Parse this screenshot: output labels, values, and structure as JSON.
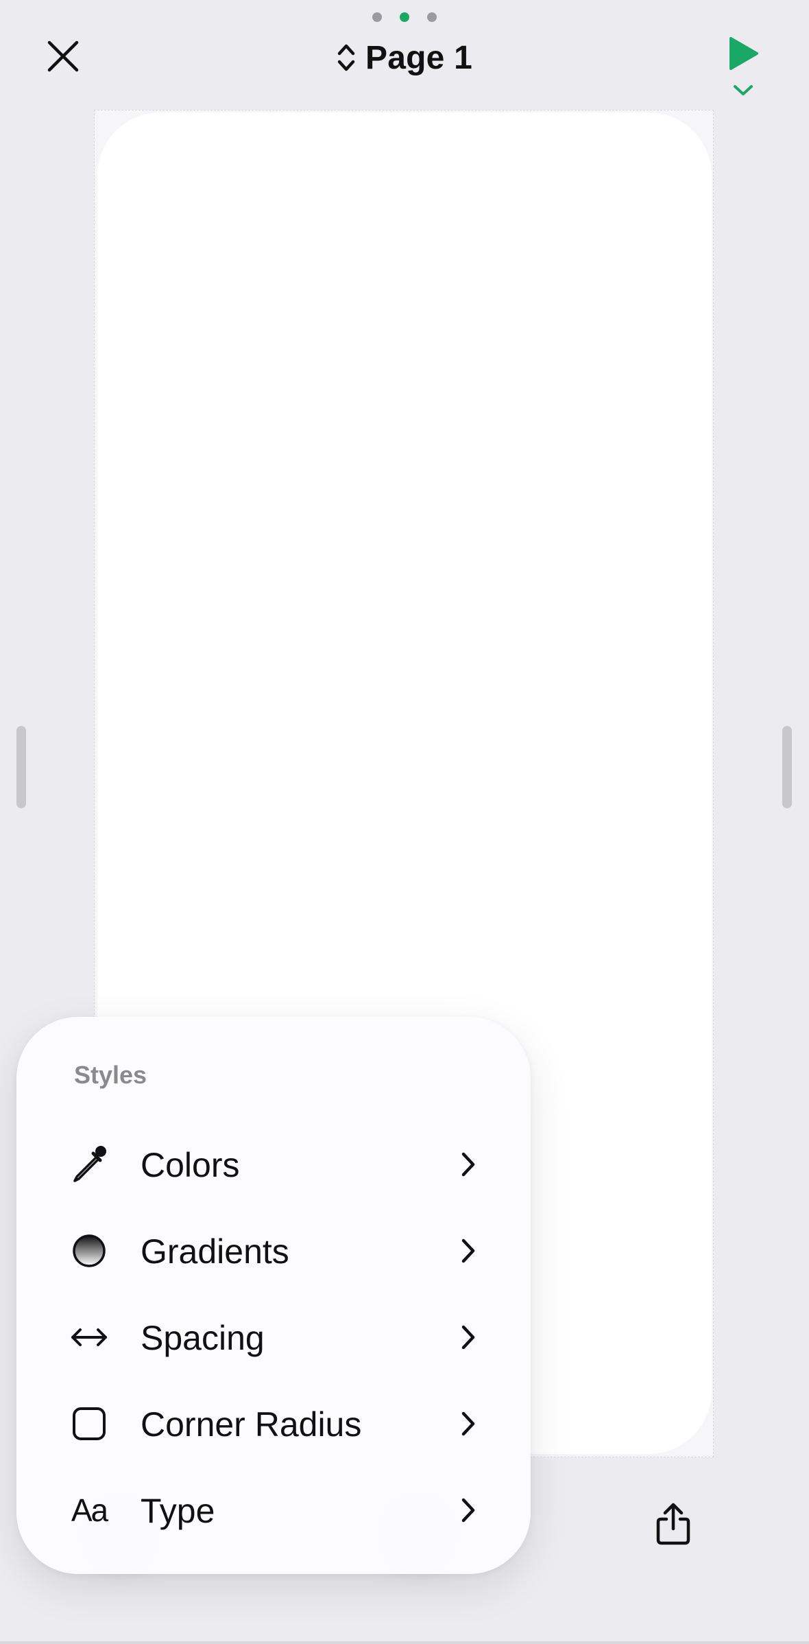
{
  "page_indicator": {
    "count": 3,
    "active_index": 1
  },
  "header": {
    "title": "Page 1",
    "accent_color": "#1aa866"
  },
  "icons": {
    "close": "close-icon",
    "page_switch": "chevron-up-down-icon",
    "play": "play-icon",
    "play_options": "chevron-down-icon",
    "share": "share-icon"
  },
  "styles_menu": {
    "title": "Styles",
    "items": [
      {
        "label": "Colors",
        "icon": "eyedropper-icon"
      },
      {
        "label": "Gradients",
        "icon": "gradient-circle-icon"
      },
      {
        "label": "Spacing",
        "icon": "arrow-left-right-icon"
      },
      {
        "label": "Corner Radius",
        "icon": "rounded-square-icon"
      },
      {
        "label": "Type",
        "icon": "type-icon",
        "glyph": "Aa"
      }
    ]
  }
}
